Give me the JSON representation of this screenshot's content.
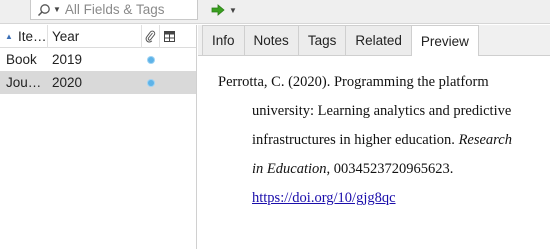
{
  "search": {
    "placeholder": "All Fields & Tags"
  },
  "items_table": {
    "columns": {
      "title": "Ite…",
      "year": "Year"
    },
    "rows": [
      {
        "title": "Book",
        "year": "2019",
        "selected": false
      },
      {
        "title": "Jou…",
        "year": "2020",
        "selected": true
      }
    ]
  },
  "tabs": [
    {
      "label": "Info"
    },
    {
      "label": "Notes"
    },
    {
      "label": "Tags"
    },
    {
      "label": "Related"
    },
    {
      "label": "Preview",
      "active": true
    }
  ],
  "preview": {
    "line1": "Perrotta, C. (2020). Programming the platform",
    "line2": "university: Learning analytics and predictive",
    "line3_plain": "infrastructures in higher education. ",
    "line3_italic": "Research",
    "line4_italic": "in Education",
    "line4_plain": ", 0034523720965623.",
    "doi_url": "https://doi.org/10/gjg8qc"
  },
  "colors": {
    "accent": "#3b6fb6",
    "attachment_dot": "#5eb3e8",
    "link": "#1a0dab",
    "locate_arrow": "#3aa020"
  }
}
